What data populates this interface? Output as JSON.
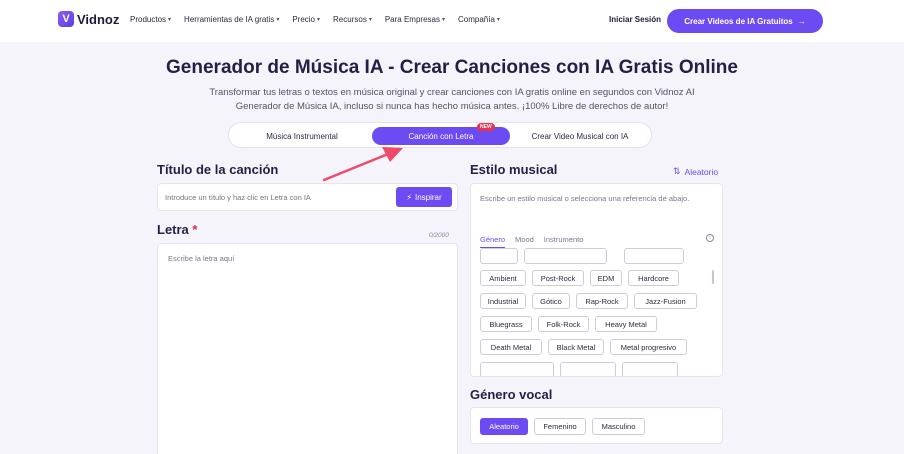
{
  "brand": {
    "name": "Vidnoz",
    "logo_letter": "V"
  },
  "nav": {
    "items": [
      "Productos",
      "Herramientas de IA gratis",
      "Precio",
      "Recursos",
      "Para Empresas",
      "Compañía"
    ],
    "login": "Iniciar Sesión",
    "cta": "Crear Videos de IA Gratuitos"
  },
  "hero": {
    "title": "Generador de Música IA - Crear Canciones con IA Gratis Online",
    "subtitle": "Transformar tus letras o textos en música original y crear canciones con IA gratis online en segundos con Vidnoz AI Generador de Música IA, incluso si nunca has hecho música antes. ¡100% Libre de derechos de autor!"
  },
  "mode_tabs": {
    "items": [
      "Música Instrumental",
      "Canción con Letra",
      "Crear Video Musical con IA"
    ],
    "active": "Canción con Letra",
    "badge": "NEW"
  },
  "song_title": {
    "label": "Título de la canción",
    "placeholder": "Introduce un título y haz clic en Letra con IA",
    "button": "Inspirar"
  },
  "lyrics": {
    "label": "Letra",
    "required_mark": "*",
    "counter": "0/2000",
    "placeholder": "Escribe la letra aquí"
  },
  "style": {
    "label": "Estilo musical",
    "random": "Aleatorio",
    "placeholder": "Escribe un estilo musical o selecciona una referencia de abajo.",
    "tabs": [
      "Género",
      "Mood",
      "Instrumento"
    ],
    "active_tab": "Género",
    "genres": [
      "Ambient",
      "Post-Rock",
      "EDM",
      "Hardcore",
      "Industrial",
      "Gótico",
      "Rap-Rock",
      "Jazz-Fusion",
      "Bluegrass",
      "Folk-Rock",
      "Heavy Metal",
      "Death Metal",
      "Black Metal",
      "Metal progresivo"
    ]
  },
  "vocal": {
    "label": "Género vocal",
    "options": [
      "Aleatorio",
      "Femenino",
      "Masculino"
    ],
    "active": "Aleatorio"
  },
  "colors": {
    "accent": "#6d4bf3",
    "badge": "#e8334c",
    "arrow": "#ef4a6a"
  }
}
